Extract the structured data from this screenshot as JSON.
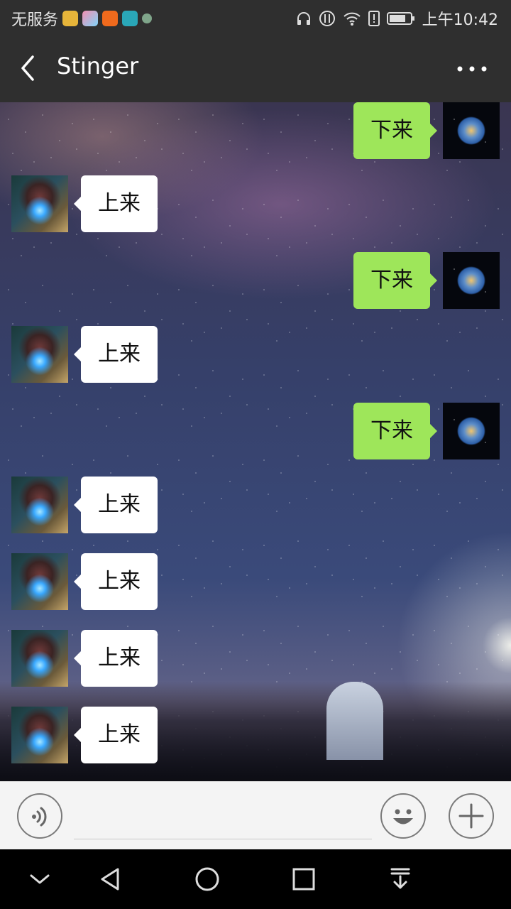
{
  "status_bar": {
    "carrier": "无服务",
    "time": "上午10:42",
    "icons": [
      "headphones-icon",
      "data-icon",
      "wifi-icon",
      "alert-icon",
      "battery-icon"
    ],
    "app_icons": [
      "star-app-icon",
      "flower-app-icon",
      "video-app-icon",
      "book-app-icon",
      "small-app-icon"
    ]
  },
  "header": {
    "title": "Stinger",
    "back_icon": "chevron-left-icon",
    "more_icon": "more-dots-icon"
  },
  "messages": [
    {
      "side": "sent",
      "text": "下来",
      "avatar": "earth-avatar"
    },
    {
      "side": "received",
      "text": "上来",
      "avatar": "ironman-avatar"
    },
    {
      "side": "sent",
      "text": "下来",
      "avatar": "earth-avatar"
    },
    {
      "side": "received",
      "text": "上来",
      "avatar": "ironman-avatar"
    },
    {
      "side": "sent",
      "text": "下来",
      "avatar": "earth-avatar"
    },
    {
      "side": "received",
      "text": "上来",
      "avatar": "ironman-avatar"
    },
    {
      "side": "received",
      "text": "上来",
      "avatar": "ironman-avatar"
    },
    {
      "side": "received",
      "text": "上来",
      "avatar": "ironman-avatar"
    },
    {
      "side": "received",
      "text": "上来",
      "avatar": "ironman-avatar"
    }
  ],
  "input_bar": {
    "voice_icon": "voice-icon",
    "text_value": "",
    "emoji_icon": "emoji-icon",
    "plus_icon": "plus-icon"
  },
  "nav_bar": {
    "icons": [
      "hide-keyboard-icon",
      "back-icon",
      "home-icon",
      "recents-icon",
      "notification-pull-icon"
    ]
  },
  "colors": {
    "header_bg": "#2f2f2f",
    "sent_bubble": "#9ee65a",
    "received_bubble": "#ffffff",
    "input_bg": "#f4f4f4"
  }
}
